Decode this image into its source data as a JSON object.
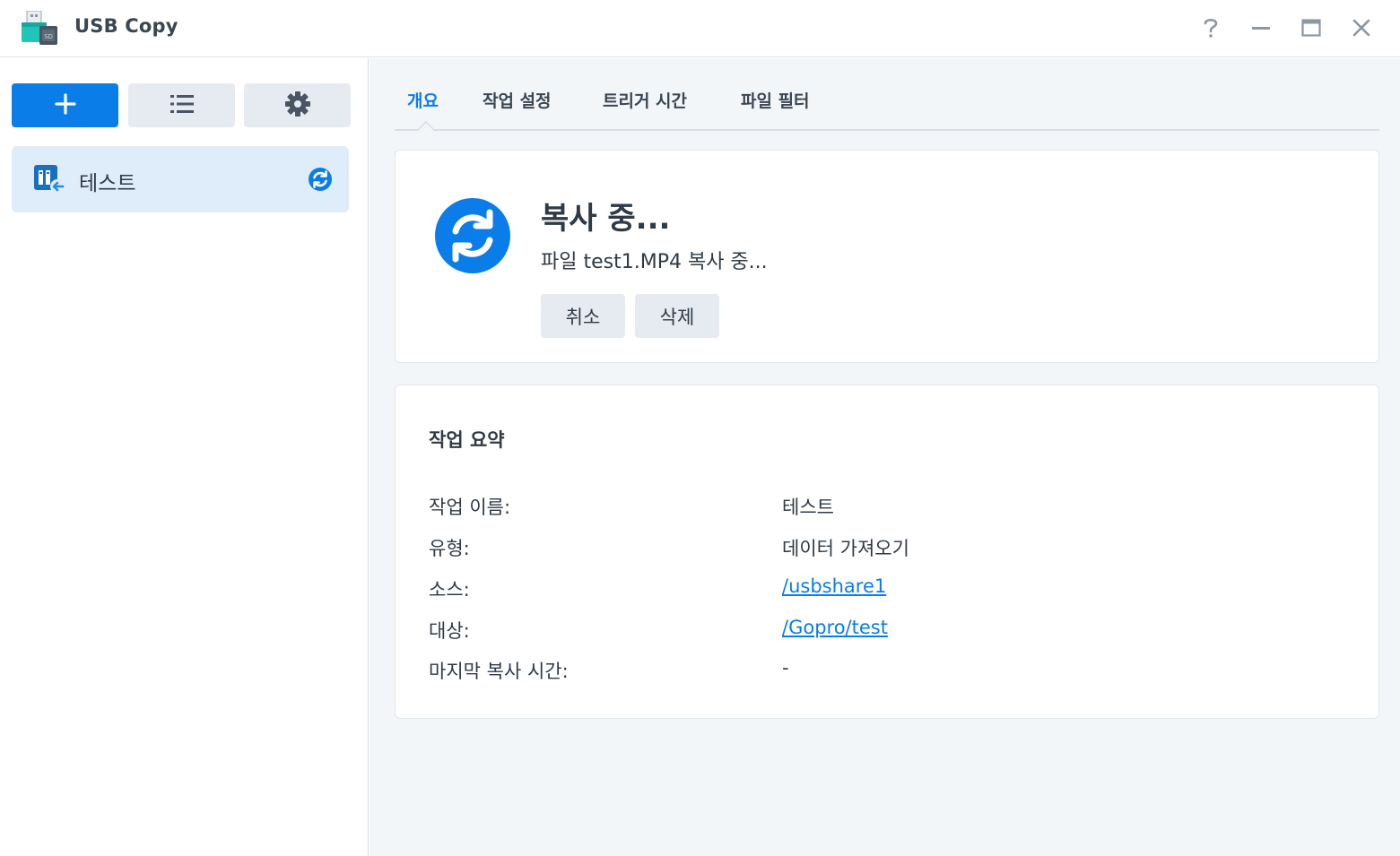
{
  "app": {
    "title": "USB Copy",
    "icon": "usb-sd-app-icon"
  },
  "window_controls": {
    "help_icon": "question-icon",
    "minimize_icon": "minimize-icon",
    "maximize_icon": "maximize-icon",
    "close_icon": "close-icon"
  },
  "toolbar": {
    "add_icon": "plus-icon",
    "list_icon": "list-icon",
    "settings_icon": "gear-icon"
  },
  "sidebar": {
    "tasks": [
      {
        "label": "테스트",
        "icon": "import-task-icon",
        "status_icon": "sync-icon"
      }
    ]
  },
  "tabs": [
    {
      "label": "개요",
      "active": true
    },
    {
      "label": "작업 설정",
      "active": false
    },
    {
      "label": "트리거 시간",
      "active": false
    },
    {
      "label": "파일 필터",
      "active": false
    }
  ],
  "status": {
    "icon": "sync-icon",
    "title": "복사 중...",
    "detail": "파일 test1.MP4 복사 중...",
    "cancel_label": "취소",
    "delete_label": "삭제"
  },
  "summary": {
    "title": "작업 요약",
    "rows": [
      {
        "label": "작업 이름:",
        "value": "테스트",
        "link": false
      },
      {
        "label": "유형:",
        "value": "데이터 가져오기",
        "link": false
      },
      {
        "label": "소스:",
        "value": "/usbshare1",
        "link": true
      },
      {
        "label": "대상:",
        "value": "/Gopro/test",
        "link": true
      },
      {
        "label": "마지막 복사 시간:",
        "value": "-",
        "link": false
      }
    ]
  },
  "colors": {
    "accent": "#0a7de8",
    "sidebar_selected": "#dfecf9",
    "main_background": "#f3f6f9",
    "button_gray": "#e6ebf1"
  }
}
